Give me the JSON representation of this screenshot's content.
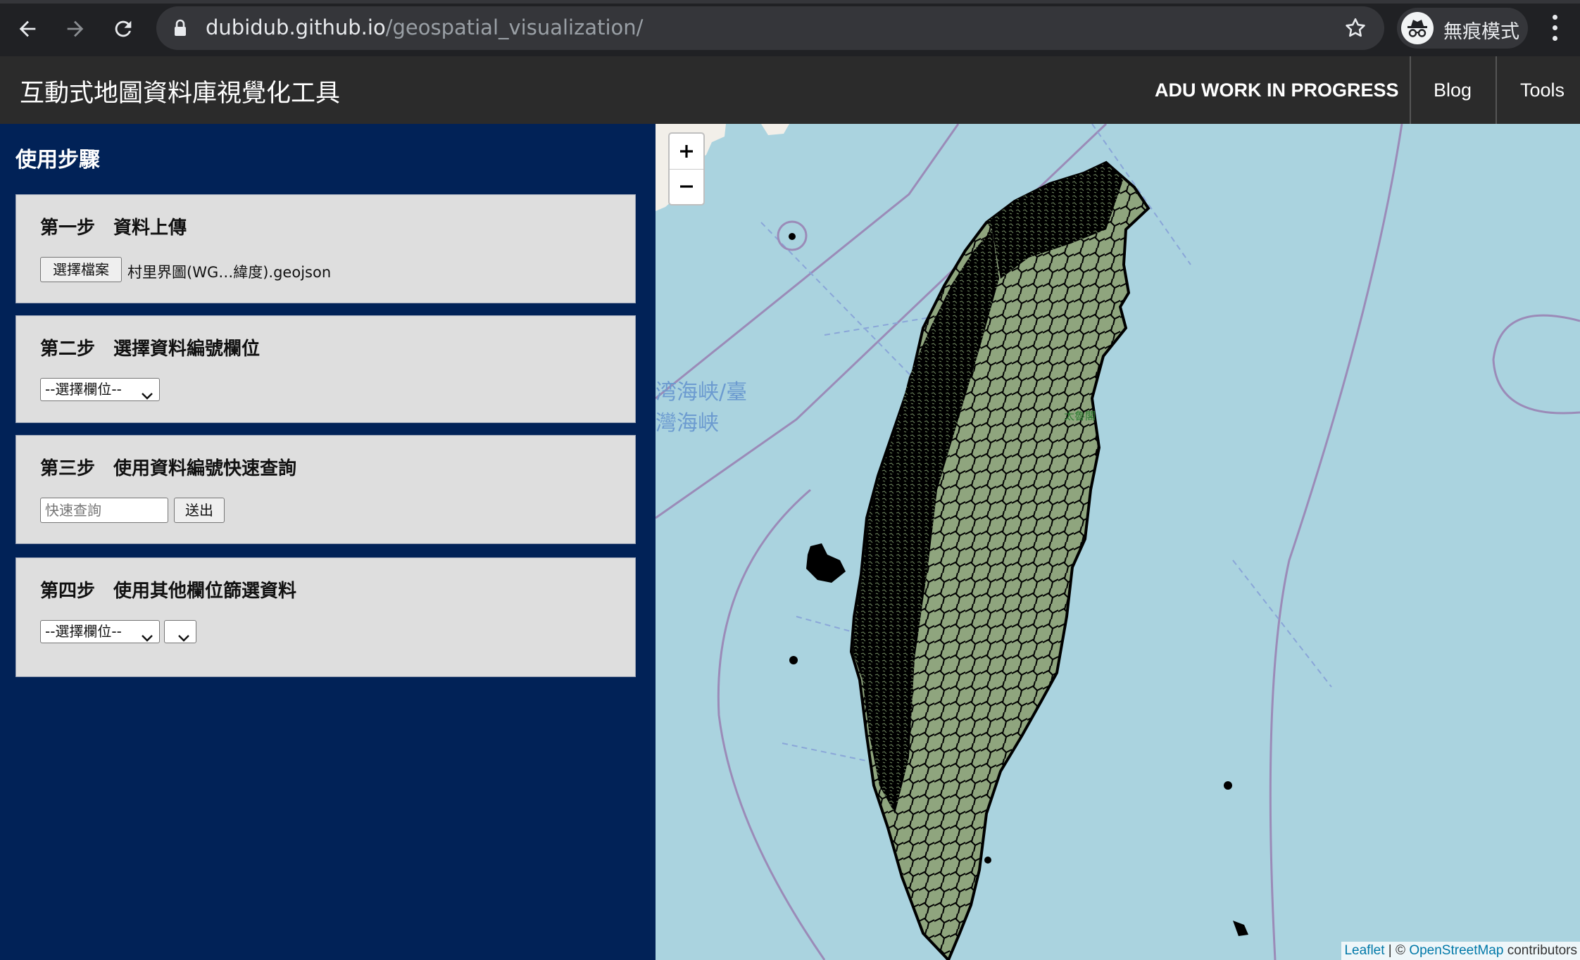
{
  "browser": {
    "url_host": "dubidub.github.io",
    "url_path": "/geospatial_visualization/",
    "profile_label": "無痕模式"
  },
  "header": {
    "title": "互動式地圖資料庫視覺化工具",
    "nav": [
      "ADU WORK IN PROGRESS",
      "Blog",
      "Tools"
    ]
  },
  "panel": {
    "title": "使用步驟",
    "steps": [
      {
        "title": "第一步　資料上傳",
        "file_button": "選擇檔案",
        "file_name": "村里界圖(WG…緯度).geojson"
      },
      {
        "title": "第二步　選擇資料編號欄位",
        "select_value": "--選擇欄位--"
      },
      {
        "title": "第三步　使用資料編號快速查詢",
        "input_placeholder": "快速查詢",
        "submit_label": "送出"
      },
      {
        "title": "第四步　使用其他欄位篩選資料",
        "select_value": "--選擇欄位--",
        "second_select_value": ""
      }
    ]
  },
  "map": {
    "zoom_in": "+",
    "zoom_out": "−",
    "strait_label": [
      "湾海峡/臺",
      "灣海峡"
    ],
    "attribution": {
      "leaflet": "Leaflet",
      "separator": " | © ",
      "osm": "OpenStreetMap",
      "suffix": " contributors"
    },
    "colors": {
      "sea": "#aad3df",
      "land": "#8fa57e",
      "boundary": "#000000",
      "maritime": "#9b8bb8"
    }
  }
}
